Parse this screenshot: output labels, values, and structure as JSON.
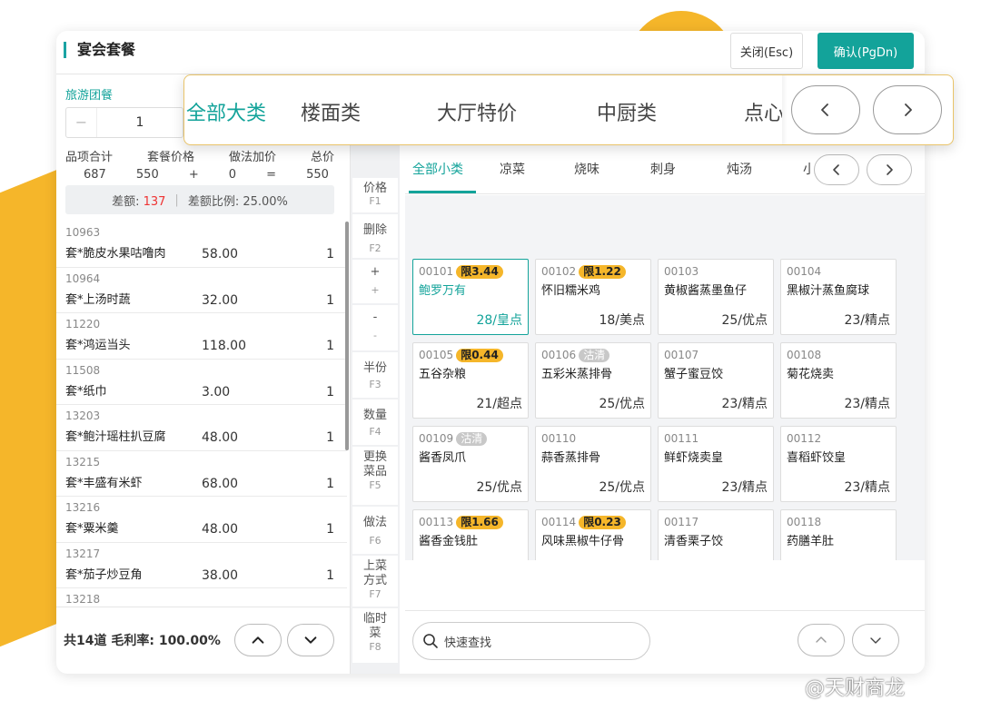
{
  "header": {
    "title": "宴会套餐",
    "close_label": "关闭(Esc)",
    "confirm_label": "确认(PgDn)"
  },
  "package": {
    "name": "旅游团餐",
    "quantity": "1",
    "minus": "−",
    "plus": "+",
    "summary_headers": [
      "品项合计",
      "套餐价格",
      "做法加价",
      "总价"
    ],
    "summary_values": [
      "687",
      "550",
      "+",
      "0",
      "=",
      "550"
    ],
    "diff_label": "差额:",
    "diff_value": "137",
    "diff_sep": "|",
    "ratio_label": "差额比例:",
    "ratio_value": "25.00%"
  },
  "dishes": [
    {
      "code": "10963",
      "name": "套*脆皮水果咕噜肉",
      "price": "58.00",
      "qty": "1"
    },
    {
      "code": "10964",
      "name": "套*上汤时蔬",
      "price": "32.00",
      "qty": "1"
    },
    {
      "code": "11220",
      "name": "套*鸿运当头",
      "price": "118.00",
      "qty": "1"
    },
    {
      "code": "11508",
      "name": "套*纸巾",
      "price": "3.00",
      "qty": "1"
    },
    {
      "code": "13203",
      "name": "套*鲍汁瑶柱扒豆腐",
      "price": "48.00",
      "qty": "1"
    },
    {
      "code": "13215",
      "name": "套*丰盛有米虾",
      "price": "68.00",
      "qty": "1"
    },
    {
      "code": "13216",
      "name": "套*粟米羹",
      "price": "48.00",
      "qty": "1"
    },
    {
      "code": "13217",
      "name": "套*茄子炒豆角",
      "price": "38.00",
      "qty": "1"
    },
    {
      "code": "13218",
      "name": "",
      "price": "",
      "qty": ""
    }
  ],
  "left_footer": {
    "summary": "共14道 毛利率: 100.00%"
  },
  "functions": [
    {
      "label": "价格",
      "key": "F1"
    },
    {
      "label": "删除",
      "key": "F2"
    },
    {
      "label": "+",
      "key": "+"
    },
    {
      "label": "-",
      "key": "-"
    },
    {
      "label": "半份",
      "key": "F3"
    },
    {
      "label": "数量",
      "key": "F4"
    },
    {
      "label": "更换菜品",
      "key": "F5"
    },
    {
      "label": "做法",
      "key": "F6"
    },
    {
      "label": "上菜方式",
      "key": "F7"
    },
    {
      "label": "临时菜",
      "key": "F8"
    }
  ],
  "categories": [
    "全部大类",
    "楼面类",
    "大厅特价",
    "中厨类",
    "点心"
  ],
  "subcategories": [
    "全部小类",
    "凉菜",
    "烧味",
    "刺身",
    "炖汤",
    "小"
  ],
  "menu_items": [
    {
      "code": "00101",
      "badge": "限3.44",
      "badge_type": "limit",
      "name": "鲍罗万有",
      "price": "28/皇点",
      "selected": true
    },
    {
      "code": "00102",
      "badge": "限1.22",
      "badge_type": "limit",
      "name": "怀旧糯米鸡",
      "price": "18/美点"
    },
    {
      "code": "00103",
      "badge": "",
      "badge_type": "",
      "name": "黄椒酱蒸墨鱼仔",
      "price": "25/优点"
    },
    {
      "code": "00104",
      "badge": "",
      "badge_type": "",
      "name": "黑椒汁蒸鱼腐球",
      "price": "23/精点"
    },
    {
      "code": "00105",
      "badge": "限0.44",
      "badge_type": "limit",
      "name": "五谷杂粮",
      "price": "21/超点"
    },
    {
      "code": "00106",
      "badge": "沽清",
      "badge_type": "sold",
      "name": "五彩米蒸排骨",
      "price": "25/优点"
    },
    {
      "code": "00107",
      "badge": "",
      "badge_type": "",
      "name": "蟹子蜜豆饺",
      "price": "23/精点"
    },
    {
      "code": "00108",
      "badge": "",
      "badge_type": "",
      "name": "菊花烧卖",
      "price": "23/精点"
    },
    {
      "code": "00109",
      "badge": "沽清",
      "badge_type": "sold",
      "name": "酱香凤爪",
      "price": "25/优点"
    },
    {
      "code": "00110",
      "badge": "",
      "badge_type": "",
      "name": "蒜香蒸排骨",
      "price": "25/优点"
    },
    {
      "code": "00111",
      "badge": "",
      "badge_type": "",
      "name": "鲜虾烧卖皇",
      "price": "23/精点"
    },
    {
      "code": "00112",
      "badge": "",
      "badge_type": "",
      "name": "喜稻虾饺皇",
      "price": "23/精点"
    },
    {
      "code": "00113",
      "badge": "限1.66",
      "badge_type": "limit",
      "name": "酱香金钱肚",
      "price": ""
    },
    {
      "code": "00114",
      "badge": "限0.23",
      "badge_type": "limit",
      "name": "风味黑椒牛仔骨",
      "price": ""
    },
    {
      "code": "00117",
      "badge": "",
      "badge_type": "",
      "name": "清香栗子饺",
      "price": ""
    },
    {
      "code": "00118",
      "badge": "",
      "badge_type": "",
      "name": "药膳羊肚",
      "price": ""
    }
  ],
  "search": {
    "placeholder": "快速查找"
  },
  "watermark": "@天财商龙",
  "colors": {
    "accent": "#13a39a",
    "highlight": "#f5b62a",
    "danger": "#ee3333"
  }
}
